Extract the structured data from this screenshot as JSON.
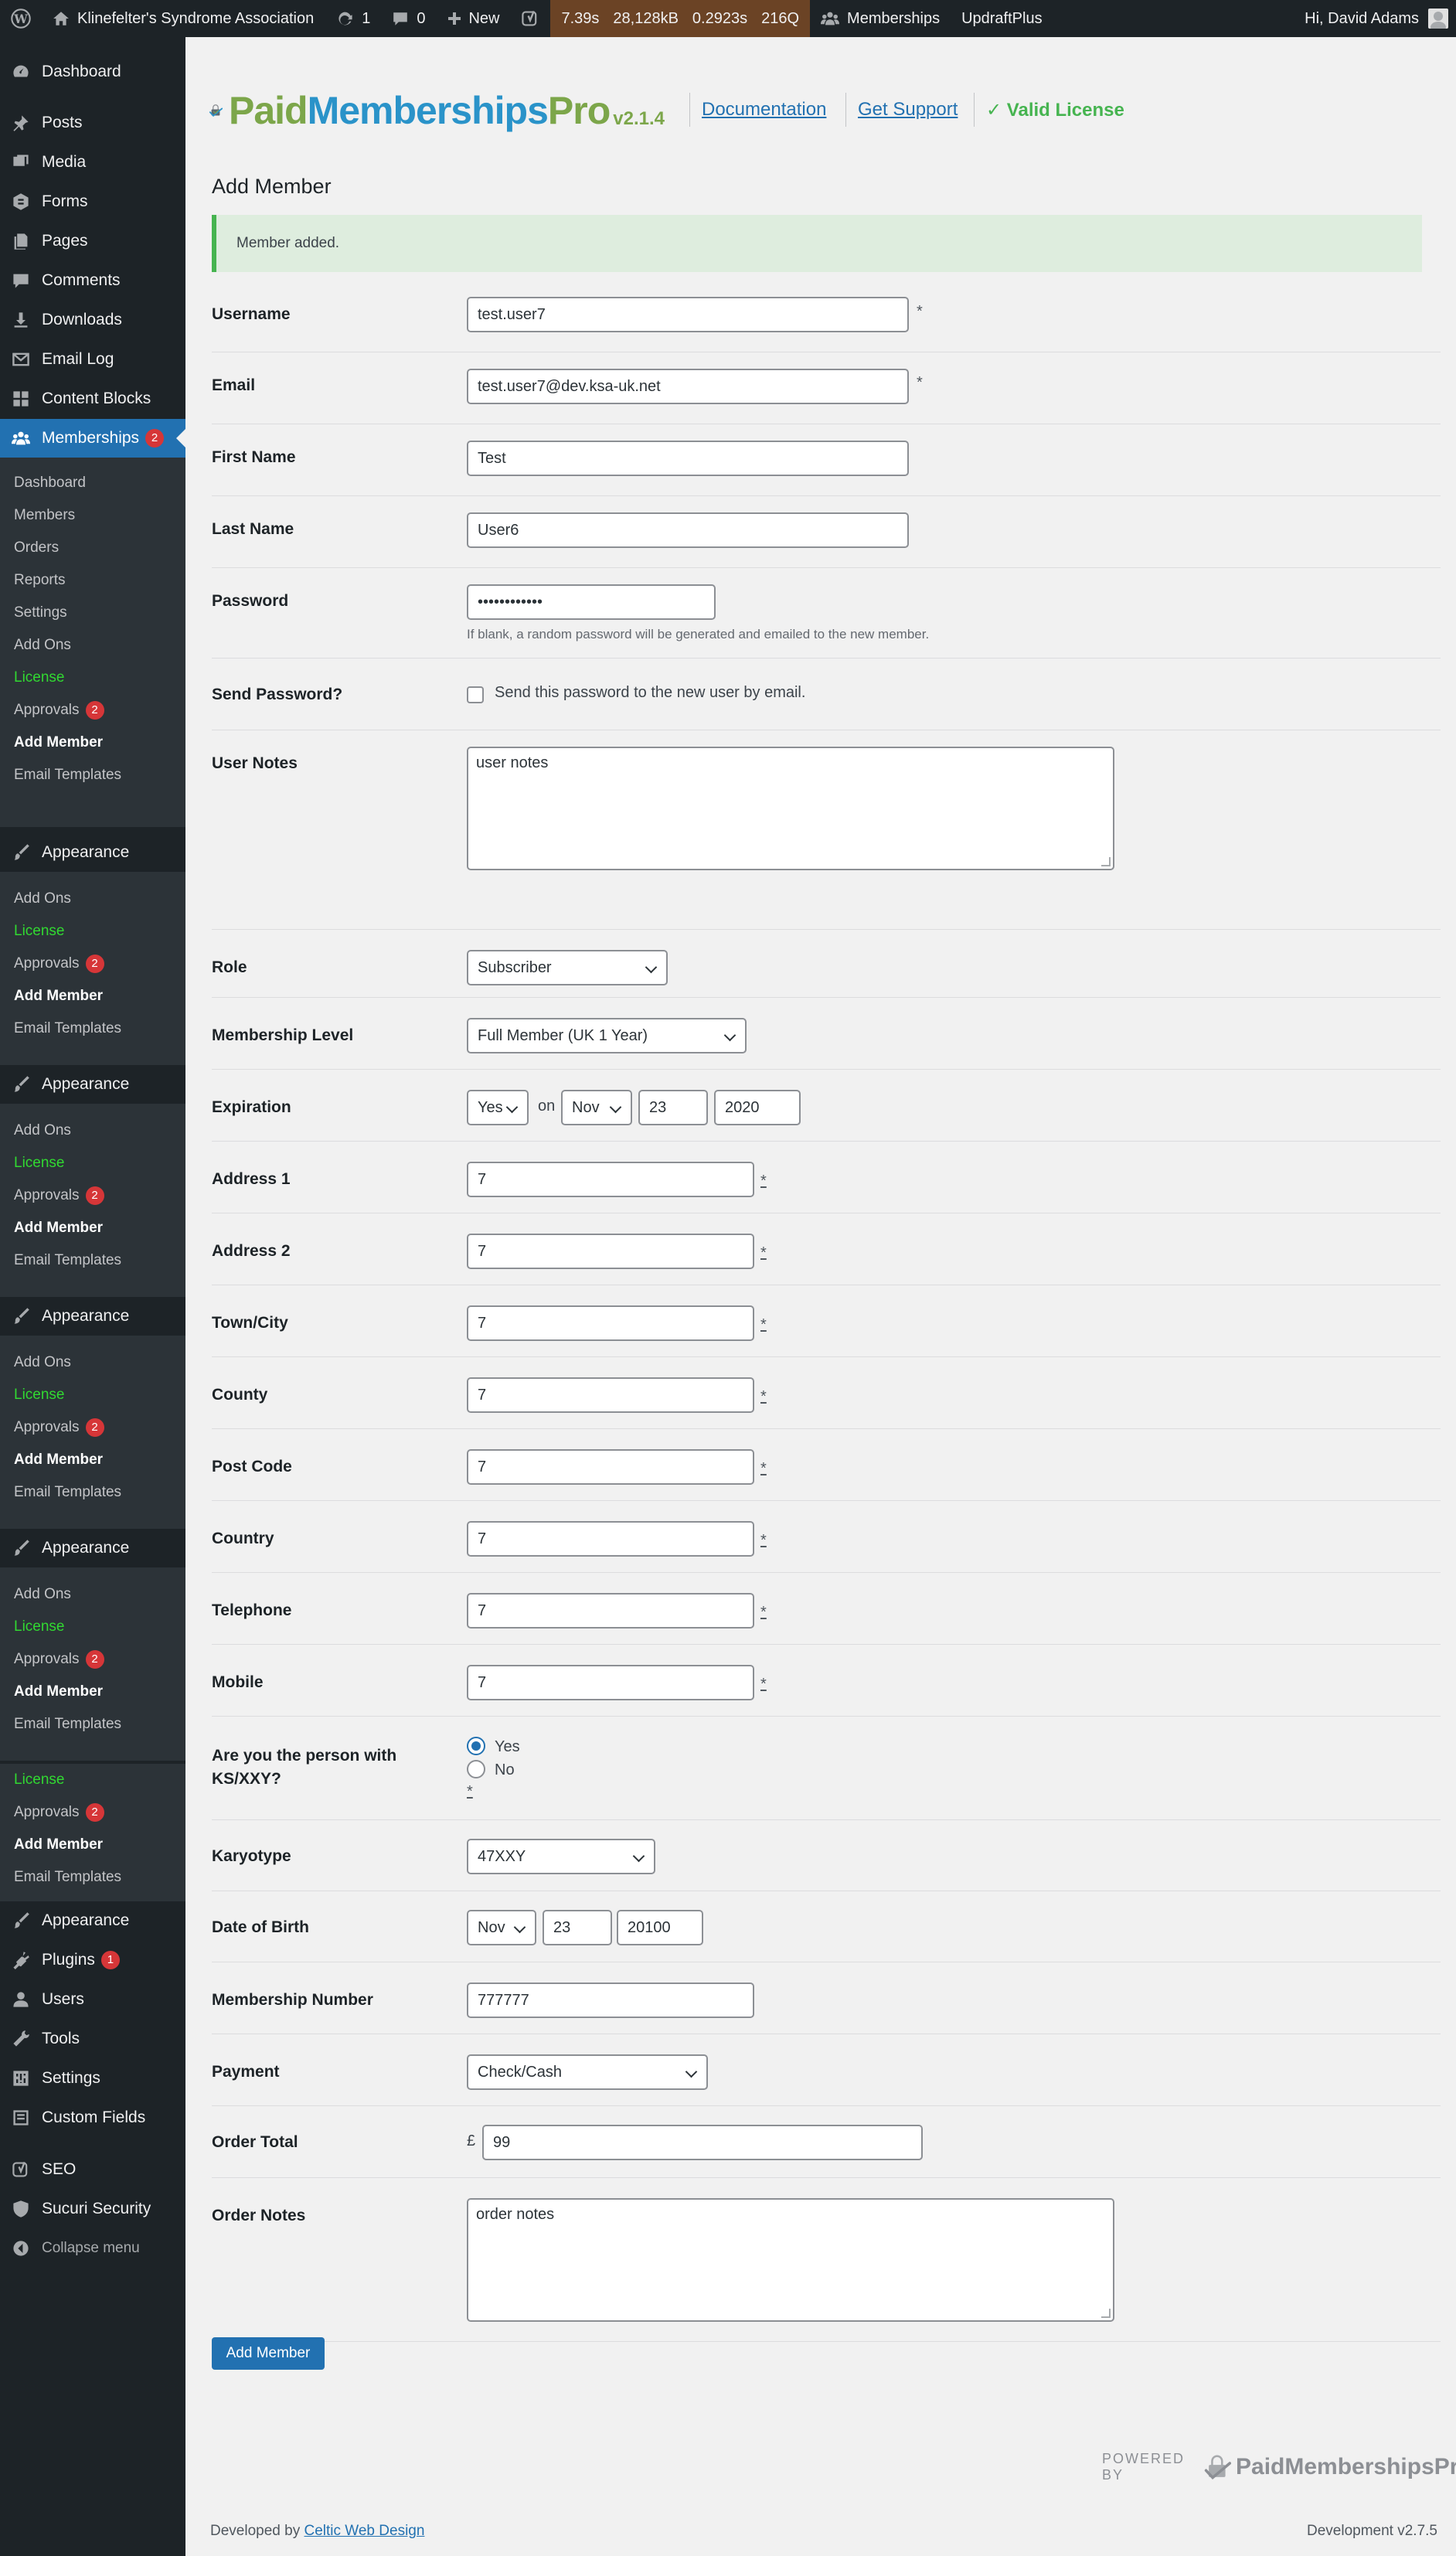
{
  "adminbar": {
    "site_name": "Klinefelter's Syndrome Association",
    "updates_count": "1",
    "comments_count": "0",
    "new_label": "New",
    "qm_time": "7.39s",
    "qm_memory": "28,128kB",
    "qm_db_time": "0.2923s",
    "qm_queries": "216Q",
    "memberships_label": "Memberships",
    "updraft_label": "UpdraftPlus",
    "greeting": "Hi, David Adams"
  },
  "sidebar": {
    "dashboard": "Dashboard",
    "posts": "Posts",
    "media": "Media",
    "forms": "Forms",
    "pages": "Pages",
    "comments": "Comments",
    "downloads": "Downloads",
    "email_log": "Email Log",
    "content_blocks": "Content Blocks",
    "memberships": "Memberships",
    "memberships_badge": "2",
    "memberships_sub": [
      "Dashboard",
      "Members",
      "Orders",
      "Reports",
      "Settings",
      "Add Ons",
      "License",
      "Approvals",
      "Add Member",
      "Email Templates"
    ],
    "appearance": "Appearance",
    "repeat_sub": [
      "Add Ons",
      "License",
      "Approvals",
      "Add Member",
      "Email Templates"
    ],
    "partial_sub": [
      "License",
      "Approvals",
      "Add Member",
      "Email Templates"
    ],
    "approvals_badge": "2",
    "plugins": "Plugins",
    "plugins_badge": "1",
    "users": "Users",
    "tools": "Tools",
    "settings": "Settings",
    "custom_fields": "Custom Fields",
    "seo": "SEO",
    "sucuri": "Sucuri Security",
    "collapse": "Collapse menu"
  },
  "header": {
    "logo_paid": "Paid",
    "logo_memberships": "Memberships",
    "logo_pro": "Pro",
    "version": "v2.1.4",
    "documentation": "Documentation",
    "support": "Get Support",
    "license": "Valid License"
  },
  "page_title": "Add Member",
  "notice": "Member added.",
  "form": {
    "username_label": "Username",
    "username_value": "test.user7",
    "email_label": "Email",
    "email_value": "test.user7@dev.ksa-uk.net",
    "first_name_label": "First Name",
    "first_name_value": "Test",
    "last_name_label": "Last Name",
    "last_name_value": "User6",
    "password_label": "Password",
    "password_value": "••••••••••••",
    "password_desc": "If blank, a random password will be generated and emailed to the new member.",
    "send_password_label": "Send Password?",
    "send_password_text": "Send this password to the new user by email.",
    "user_notes_label": "User Notes",
    "user_notes_value": "user notes",
    "role_label": "Role",
    "role_value": "Subscriber",
    "level_label": "Membership Level",
    "level_value": "Full Member (UK 1 Year)",
    "expiration_label": "Expiration",
    "expiration_enabled": "Yes",
    "expiration_on": "on",
    "expiration_month": "Nov",
    "expiration_day": "23",
    "expiration_year": "2020",
    "address1_label": "Address 1",
    "address1_value": "7",
    "address2_label": "Address 2",
    "address2_value": "7",
    "town_label": "Town/City",
    "town_value": "7",
    "county_label": "County",
    "county_value": "7",
    "postcode_label": "Post Code",
    "postcode_value": "7",
    "country_label": "Country",
    "country_value": "7",
    "telephone_label": "Telephone",
    "telephone_value": "7",
    "mobile_label": "Mobile",
    "mobile_value": "7",
    "ks_label": "Are you the person with KS/XXY?",
    "ks_yes": "Yes",
    "ks_no": "No",
    "karyotype_label": "Karyotype",
    "karyotype_value": "47XXY",
    "dob_label": "Date of Birth",
    "dob_month": "Nov",
    "dob_day": "23",
    "dob_year": "20100",
    "membership_number_label": "Membership Number",
    "membership_number_value": "777777",
    "payment_label": "Payment",
    "payment_value": "Check/Cash",
    "order_total_label": "Order Total",
    "currency": "£",
    "order_total_value": "99",
    "order_notes_label": "Order Notes",
    "order_notes_value": "order notes",
    "required_mark": "*",
    "submit": "Add Member"
  },
  "footer": {
    "powered_by": "POWERED BY",
    "powered_logo": "PaidMembershipsPro",
    "developed_by": "Developed by",
    "developer_link": "Celtic Web Design",
    "version": "Development v2.7.5"
  },
  "colors": {
    "admin_dark": "#1d2327",
    "submenu": "#2c3338",
    "accent_blue": "#2271b1",
    "license_green": "#46b450",
    "badge_red": "#d63638"
  }
}
